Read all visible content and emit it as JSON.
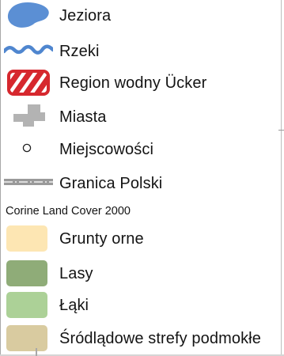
{
  "legend": {
    "items": [
      {
        "label": "Jeziora",
        "symbol": "lake-icon",
        "color": "#5b8fd4"
      },
      {
        "label": "Rzeki",
        "symbol": "river-icon",
        "color": "#4f86cf"
      },
      {
        "label": "Region wodny Ücker",
        "symbol": "water-region-icon",
        "color": "#d6282e"
      },
      {
        "label": "Miasta",
        "symbol": "city-icon",
        "color": "#b3b3b3"
      },
      {
        "label": "Miejscowości",
        "symbol": "locality-icon",
        "color": "#222222"
      },
      {
        "label": "Granica Polski",
        "symbol": "border-line-icon",
        "color": "#7a7a7a"
      }
    ],
    "corine": {
      "title": "Corine Land Cover 2000",
      "items": [
        {
          "label": "Grunty orne",
          "color": "#fde6b3"
        },
        {
          "label": "Lasy",
          "color": "#8fac78"
        },
        {
          "label": "Łąki",
          "color": "#acd197"
        },
        {
          "label": "Śródlądowe strefy podmokłe",
          "color": "#d9cba0"
        }
      ]
    }
  }
}
